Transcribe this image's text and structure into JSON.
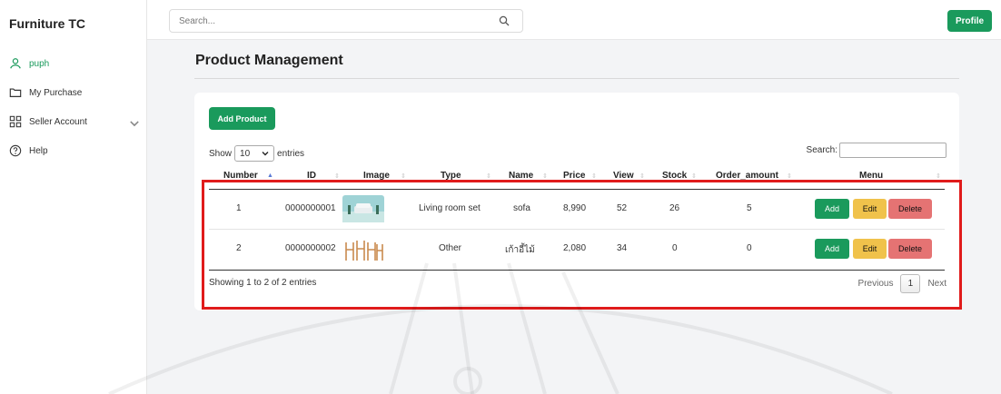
{
  "brand": "Furniture TC",
  "sidebar": {
    "items": [
      {
        "label": "puph",
        "icon": "user-icon"
      },
      {
        "label": "My Purchase",
        "icon": "folder-icon"
      },
      {
        "label": "Seller Account",
        "icon": "grid-icon"
      },
      {
        "label": "Help",
        "icon": "help-icon"
      }
    ]
  },
  "topbar": {
    "search_placeholder": "Search...",
    "profile_label": "Profile"
  },
  "page": {
    "title": "Product Management"
  },
  "card": {
    "add_product_label": "Add Product",
    "show_label": "Show",
    "entries_value": "10",
    "entries_label": "entries",
    "search_label": "Search:",
    "columns": [
      "Number",
      "ID",
      "Image",
      "Type",
      "Name",
      "Price",
      "View",
      "Stock",
      "Order_amount",
      "Menu"
    ],
    "rows": [
      {
        "number": "1",
        "id": "0000000001",
        "type": "Living room set",
        "name": "sofa",
        "price": "8,990",
        "view": "52",
        "stock": "26",
        "order_amount": "5"
      },
      {
        "number": "2",
        "id": "0000000002",
        "type": "Other",
        "name": "เก้าอี้ไม้",
        "price": "2,080",
        "view": "34",
        "stock": "0",
        "order_amount": "0"
      }
    ],
    "actions": {
      "add": "Add",
      "edit": "Edit",
      "delete": "Delete"
    },
    "showing_text": "Showing 1 to 2 of 2 entries",
    "pager": {
      "previous": "Previous",
      "page": "1",
      "next": "Next"
    }
  },
  "colors": {
    "accent": "#1a9a5c",
    "edit": "#f0c24b",
    "delete": "#e57373",
    "highlight": "#e01b1b"
  }
}
